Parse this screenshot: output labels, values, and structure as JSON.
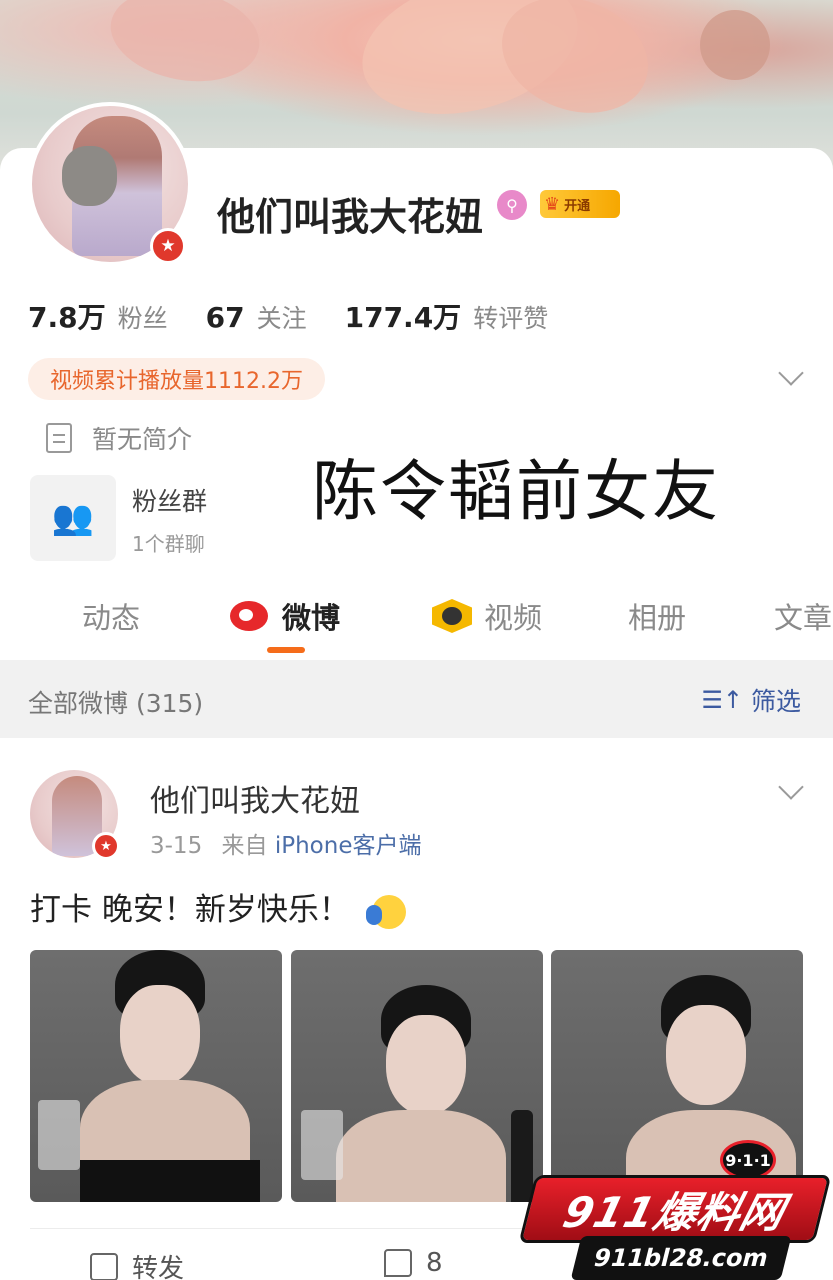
{
  "profile": {
    "name": "他们叫我大花妞",
    "vip_label": "开通",
    "stats": [
      {
        "value": "7.8万",
        "label": "粉丝"
      },
      {
        "value": "67",
        "label": "关注"
      },
      {
        "value": "177.4万",
        "label": "转评赞"
      }
    ],
    "video_plays": "视频累计播放量1112.2万",
    "bio": "暂无简介",
    "fan_group": {
      "title": "粉丝群",
      "sub": "1个群聊"
    }
  },
  "overlay_caption": "陈令韬前女友",
  "tabs": [
    {
      "label": "动态",
      "active": false
    },
    {
      "label": "微博",
      "active": true
    },
    {
      "label": "视频",
      "active": false
    },
    {
      "label": "相册",
      "active": false
    },
    {
      "label": "文章",
      "active": false
    }
  ],
  "filter": {
    "label": "全部微博 (315)",
    "button": "筛选"
  },
  "post": {
    "author": "他们叫我大花妞",
    "date": "3-15",
    "from_prefix": "来自",
    "source": "iPhone客户端",
    "text": "打卡 晚安！新岁快乐！",
    "actions": {
      "repost": "转发",
      "comments": "8"
    }
  },
  "watermark": {
    "badge": "9·1·1",
    "brand": "911爆料网",
    "url": "911bl28.com"
  },
  "colors": {
    "accent": "#f56c1a",
    "verify": "#e0382c",
    "link": "#4c6ea8",
    "vip": "#f6a700"
  }
}
